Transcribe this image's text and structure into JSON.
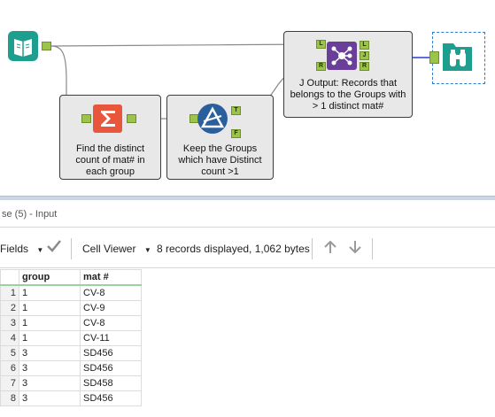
{
  "workflow": {
    "summarize_tool": {
      "label": "Find the distinct\ncount of mat# in\neach group"
    },
    "filter_tool": {
      "label": "Keep the Groups\nwhich have Distinct\ncount >1",
      "anchor_true": "T",
      "anchor_false": "F"
    },
    "join_tool": {
      "label": "J Output: Records that\nbelongs to the Groups with\n> 1 distinct mat#",
      "anchor_left_in": "L",
      "anchor_right_in": "R",
      "anchor_left_out": "L",
      "anchor_join_out": "J",
      "anchor_right_out": "R"
    }
  },
  "results": {
    "title": "se (5) - Input",
    "toolbar": {
      "fields_label": "Fields",
      "cell_viewer_label": "Cell Viewer",
      "status": "8 records displayed, 1,062 bytes"
    },
    "columns": [
      "group",
      "mat #"
    ],
    "rows": [
      {
        "num": "1",
        "group": "1",
        "mat": "CV-8"
      },
      {
        "num": "2",
        "group": "1",
        "mat": "CV-9"
      },
      {
        "num": "3",
        "group": "1",
        "mat": "CV-8"
      },
      {
        "num": "4",
        "group": "1",
        "mat": "CV-11"
      },
      {
        "num": "5",
        "group": "3",
        "mat": "SD456"
      },
      {
        "num": "6",
        "group": "3",
        "mat": "SD456"
      },
      {
        "num": "7",
        "group": "3",
        "mat": "SD458"
      },
      {
        "num": "8",
        "group": "3",
        "mat": "SD456"
      }
    ]
  },
  "colors": {
    "input_tool": "#1e9e8e",
    "summarize_tool": "#e8573c",
    "filter_tool": "#2a5f9e",
    "join_tool": "#6a3f9a",
    "browse_tool": "#1e9e8e",
    "anchor": "#9dc44a",
    "join_wire": "#2b3fd0"
  },
  "icons": {
    "input": "book-icon",
    "summarize": "sigma-icon",
    "filter": "filter-triangle-icon",
    "join": "join-icon",
    "browse": "binoculars-icon"
  }
}
